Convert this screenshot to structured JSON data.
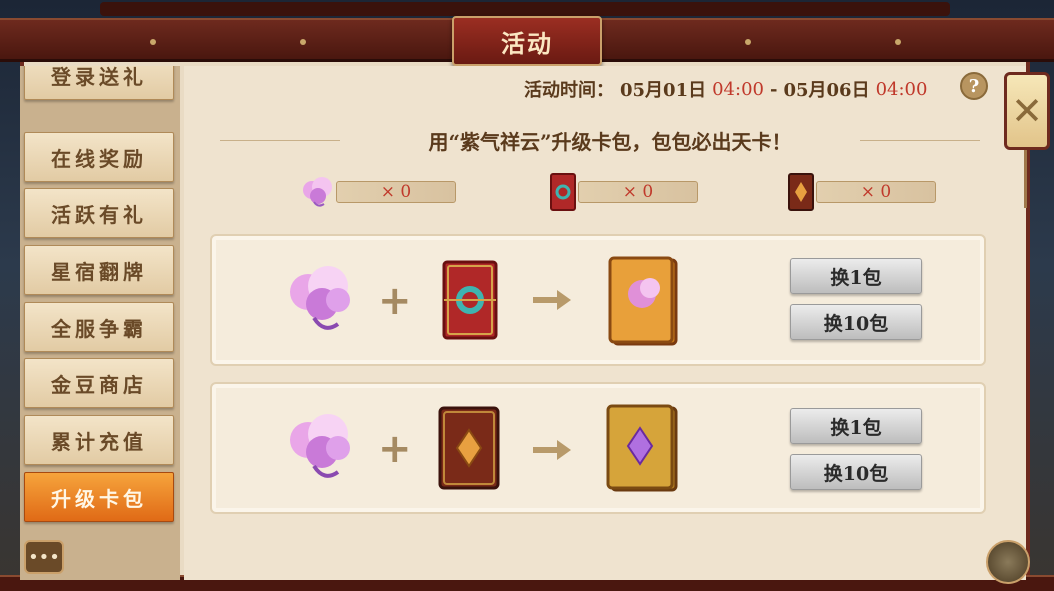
{
  "window": {
    "title": "活动",
    "close_icon": "close-icon",
    "help_label": "?"
  },
  "time": {
    "label": "活动时间：",
    "start_date": "05月01日",
    "start_time": "04:00",
    "separator": "-",
    "end_date": "05月06日",
    "end_time": "04:00"
  },
  "sidebar": {
    "items": [
      {
        "label": "登录送礼"
      },
      {
        "label": "在线奖励"
      },
      {
        "label": "活跃有礼"
      },
      {
        "label": "星宿翻牌"
      },
      {
        "label": "全服争霸"
      },
      {
        "label": "金豆商店"
      },
      {
        "label": "累计充值"
      },
      {
        "label": "升级卡包",
        "active": true
      }
    ]
  },
  "main": {
    "subtitle": "用“紫气祥云”升级卡包，包包必出天卡！",
    "counters": [
      {
        "icon": "purple-cloud-icon",
        "count": "× 0"
      },
      {
        "icon": "red-card-pack-icon",
        "count": "× 0"
      },
      {
        "icon": "brown-card-pack-icon",
        "count": "× 0"
      }
    ],
    "recipes": [
      {
        "plus": "+",
        "buttons": {
          "one": "换1包",
          "ten": "换10包"
        }
      },
      {
        "plus": "+",
        "buttons": {
          "one": "换1包",
          "ten": "换10包"
        }
      }
    ]
  },
  "footer": {
    "chat_label": "•••"
  },
  "colors": {
    "frame": "#6e2a1e",
    "accent_red": "#c0392b",
    "active_tab": "#e06a16",
    "parchment": "#efe3cf"
  }
}
